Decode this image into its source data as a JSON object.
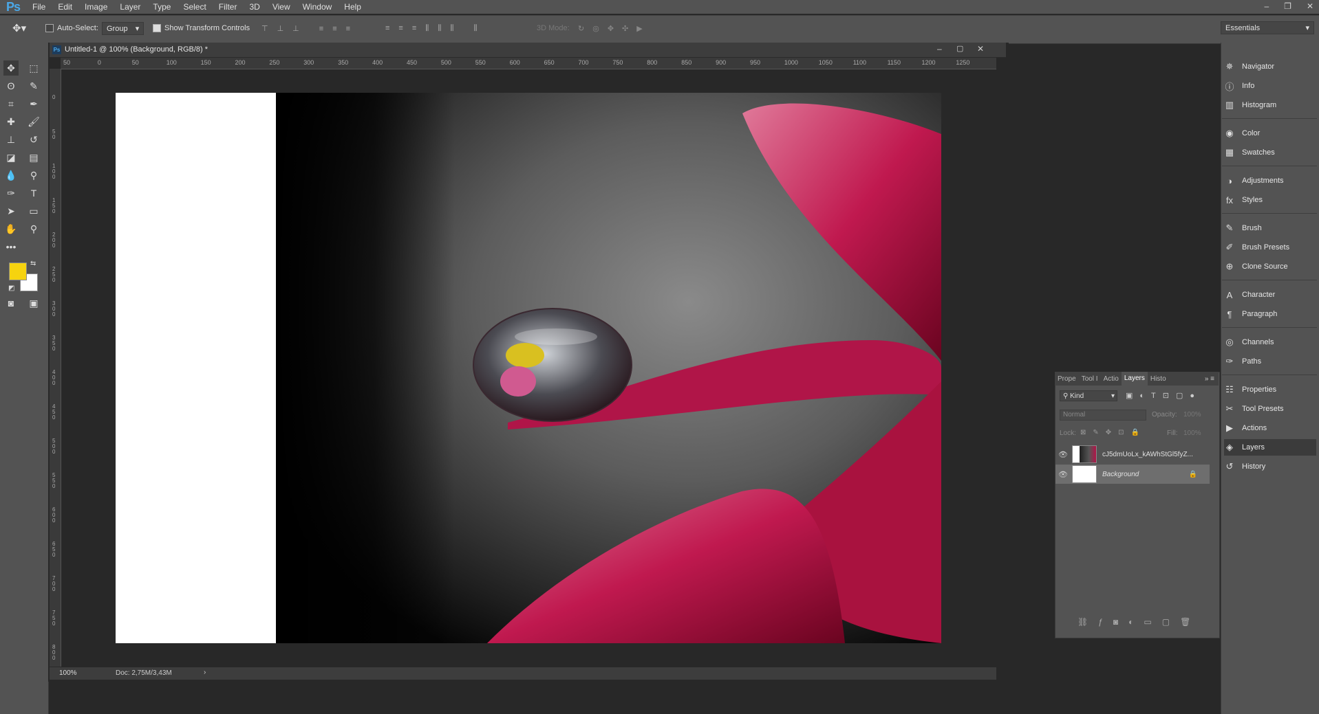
{
  "app": {
    "logo": "Ps"
  },
  "menu": [
    "File",
    "Edit",
    "Image",
    "Layer",
    "Type",
    "Select",
    "Filter",
    "3D",
    "View",
    "Window",
    "Help"
  ],
  "window_controls": [
    "–",
    "❐",
    "✕"
  ],
  "options_bar": {
    "auto_select_label": "Auto-Select:",
    "auto_select_mode": "Group",
    "show_transform_label": "Show Transform Controls",
    "mode_3d_label": "3D Mode:",
    "workspace": "Essentials"
  },
  "document": {
    "tab_title": "Untitled-1 @ 100% (Background, RGB/8) *",
    "ruler_h": [
      "50",
      "0",
      "50",
      "100",
      "150",
      "200",
      "250",
      "300",
      "350",
      "400",
      "450",
      "500",
      "550",
      "600",
      "650",
      "700",
      "750",
      "800",
      "850",
      "900",
      "950",
      "1000",
      "1050",
      "1100",
      "1150",
      "1200",
      "1250"
    ],
    "ruler_v": [
      "0",
      "5 0",
      "1 0 0",
      "1 5 0",
      "2 0 0",
      "2 5 0",
      "3 0 0",
      "3 5 0",
      "4 0 0",
      "4 5 0",
      "5 0 0",
      "5 5 0",
      "6 0 0",
      "6 5 0",
      "7 0 0",
      "7 5 0",
      "8 0 0"
    ],
    "zoom": "100%",
    "doc_info": "Doc: 2,75M/3,43M"
  },
  "right_panels": [
    {
      "label": "Navigator",
      "icon": "navigator-icon"
    },
    {
      "label": "Info",
      "icon": "info-icon"
    },
    {
      "label": "Histogram",
      "icon": "histogram-icon"
    },
    {
      "label": "Color",
      "icon": "color-icon"
    },
    {
      "label": "Swatches",
      "icon": "swatches-icon"
    },
    {
      "label": "Adjustments",
      "icon": "adjustments-icon"
    },
    {
      "label": "Styles",
      "icon": "styles-icon"
    },
    {
      "label": "Brush",
      "icon": "brush-icon"
    },
    {
      "label": "Brush Presets",
      "icon": "brush-presets-icon"
    },
    {
      "label": "Clone Source",
      "icon": "clone-source-icon"
    },
    {
      "label": "Character",
      "icon": "character-icon"
    },
    {
      "label": "Paragraph",
      "icon": "paragraph-icon"
    },
    {
      "label": "Channels",
      "icon": "channels-icon"
    },
    {
      "label": "Paths",
      "icon": "paths-icon"
    },
    {
      "label": "Properties",
      "icon": "properties-icon"
    },
    {
      "label": "Tool Presets",
      "icon": "tool-presets-icon"
    },
    {
      "label": "Actions",
      "icon": "actions-icon"
    },
    {
      "label": "Layers",
      "icon": "layers-icon"
    },
    {
      "label": "History",
      "icon": "history-icon"
    }
  ],
  "layers_panel": {
    "tabs": [
      "Prope",
      "Tool I",
      "Actio",
      "Layers",
      "Histo"
    ],
    "filter_kind": "Kind",
    "blend_mode": "Normal",
    "opacity_label": "Opacity:",
    "opacity_value": "100%",
    "lock_label": "Lock:",
    "fill_label": "Fill:",
    "fill_value": "100%",
    "layers": [
      {
        "name": "cJ5dmUoLx_kAWhStGl5fyZ..."
      },
      {
        "name": "Background"
      }
    ]
  },
  "colors": {
    "foreground": "#f6d30f",
    "background": "#ffffff"
  }
}
